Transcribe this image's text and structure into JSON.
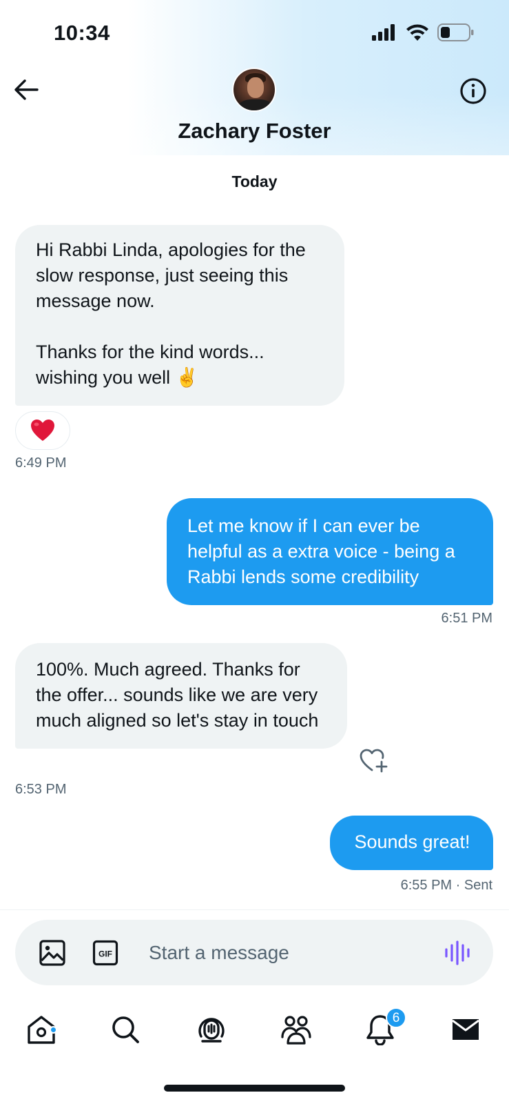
{
  "status_bar": {
    "time": "10:34"
  },
  "header": {
    "contact_name": "Zachary Foster"
  },
  "thread": {
    "day_label": "Today",
    "messages": [
      {
        "direction": "in",
        "text": "Hi Rabbi Linda, apologies for the slow response, just seeing this message now.\n\nThanks for the kind words... wishing you well ✌️",
        "time": "6:49 PM",
        "reaction": "❤️"
      },
      {
        "direction": "out",
        "text": "Let me know if I can ever be helpful as a extra voice - being a Rabbi lends some credibility",
        "time": "6:51 PM"
      },
      {
        "direction": "in",
        "text": "100%. Much agreed. Thanks for the offer... sounds like we are very much aligned so let's stay in touch",
        "time": "6:53 PM"
      },
      {
        "direction": "out",
        "text": "Sounds great!",
        "time": "6:55 PM",
        "status": " · Sent"
      }
    ]
  },
  "composer": {
    "placeholder": "Start a message",
    "gif_label": "GIF"
  },
  "tabbar": {
    "notifications_count": "6"
  },
  "colors": {
    "accent": "#1d9bf0",
    "incoming_bubble": "#eff3f4",
    "muted_text": "#536471",
    "voice_icon": "#7856ff"
  },
  "icons": [
    "back-arrow-icon",
    "info-icon",
    "heart-icon",
    "heart-plus-icon",
    "image-icon",
    "gif-icon",
    "voice-icon",
    "home-icon",
    "search-icon",
    "spaces-icon",
    "communities-icon",
    "bell-icon",
    "envelope-icon"
  ]
}
